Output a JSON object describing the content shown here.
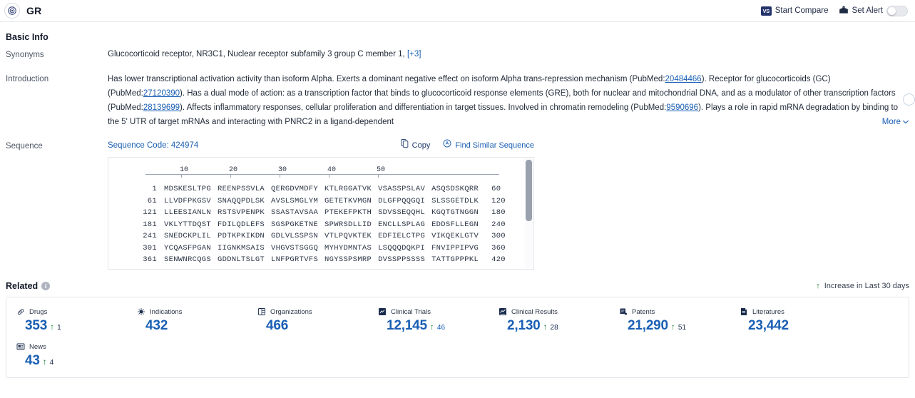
{
  "header": {
    "brand_title": "GR",
    "logo_icon": "target-icon",
    "start_compare_label": "Start Compare",
    "start_compare_badge": "VS",
    "set_alert_label": "Set Alert",
    "set_alert_icon": "alert-mailbox-icon",
    "toggle_state": "off"
  },
  "basic_info": {
    "title": "Basic Info",
    "synonyms": {
      "label": "Synonyms",
      "items": [
        "Glucocorticoid receptor,",
        "NR3C1,",
        "Nuclear receptor subfamily 3 group C member 1,"
      ],
      "more_label": "[+3]"
    },
    "introduction": {
      "label": "Introduction",
      "segments": [
        {
          "type": "text",
          "value": "Has lower transcriptional activation activity than isoform Alpha. Exerts a dominant negative effect on isoform Alpha trans-repression mechanism (PubMed:"
        },
        {
          "type": "link",
          "value": "20484466"
        },
        {
          "type": "text",
          "value": "). Receptor for glucocorticoids (GC) (PubMed:"
        },
        {
          "type": "link",
          "value": "27120390"
        },
        {
          "type": "text",
          "value": "). Has a dual mode of action: as a transcription factor that binds to glucocorticoid response elements (GRE), both for nuclear and mitochondrial DNA, and as a modulator of other transcription factors (PubMed:"
        },
        {
          "type": "link",
          "value": "28139699"
        },
        {
          "type": "text",
          "value": "). Affects inflammatory responses, cellular proliferation and differentiation in target tissues. Involved in chromatin remodeling (PubMed:"
        },
        {
          "type": "link",
          "value": "9590696"
        },
        {
          "type": "text",
          "value": "). Plays a role in rapid mRNA degradation by binding to the 5' UTR of target mRNAs and interacting with PNRC2 in a ligand-dependent"
        }
      ],
      "more_label": "More"
    }
  },
  "sequence": {
    "label": "Sequence",
    "code_label": "Sequence Code: 424974",
    "copy_label": "Copy",
    "copy_icon": "copy-icon",
    "find_similar_label": "Find Similar Sequence",
    "find_similar_icon": "find-similar-icon",
    "ruler_ticks": [
      10,
      20,
      30,
      40,
      50
    ],
    "rows": [
      {
        "start": "1",
        "chunks": [
          "MDSKESLTPG",
          "REENPSSVLA",
          "QERGDVMDFY",
          "KTLRGGATVK",
          "VSASSPSLAV",
          "ASQSDSKQRR"
        ],
        "end": "60"
      },
      {
        "start": "61",
        "chunks": [
          "LLVDFPKGSV",
          "SNAQQPDLSK",
          "AVSLSMGLYM",
          "GETETKVMGN",
          "DLGFPQQGQI",
          "SLSSGETDLK"
        ],
        "end": "120"
      },
      {
        "start": "121",
        "chunks": [
          "LLEESIANLN",
          "RSTSVPENPK",
          "SSASTAVSAA",
          "PTEKEFPKTH",
          "SDVSSEQQHL",
          "KGQTGTNGGN"
        ],
        "end": "180"
      },
      {
        "start": "181",
        "chunks": [
          "VKLYTTDQST",
          "FDILQDLEFS",
          "SGSPGKETNE",
          "SPWRSDLLID",
          "ENCLLSPLAG",
          "EDDSFLLEGN"
        ],
        "end": "240"
      },
      {
        "start": "241",
        "chunks": [
          "SNEDCKPLIL",
          "PDTKPKIKDN",
          "GDLVLSSPSN",
          "VTLPQVKTEK",
          "EDFIELCTPG",
          "VIKQEKLGTV"
        ],
        "end": "300"
      },
      {
        "start": "301",
        "chunks": [
          "YCQASFPGAN",
          "IIGNKMSAIS",
          "VHGVSTSGGQ",
          "MYHYDMNTAS",
          "LSQQQDQKPI",
          "FNVIPPIPVG"
        ],
        "end": "360"
      },
      {
        "start": "361",
        "chunks": [
          "SENWNRCQGS",
          "GDDNLTSLGT",
          "LNFPGRTVFS",
          "NGYSSPSMRP",
          "DVSSPPSSSS",
          "TATTGPPPKL"
        ],
        "end": "420"
      }
    ]
  },
  "related": {
    "title": "Related",
    "info_icon": "info-icon",
    "legend_label": "Increase in Last 30 days",
    "legend_arrow": "↑",
    "cards": [
      {
        "label": "Drugs",
        "icon": "capsule-icon",
        "value": "353",
        "delta": "1",
        "delta_color": "dark"
      },
      {
        "label": "Indications",
        "icon": "virus-icon",
        "value": "432",
        "delta": "",
        "delta_color": ""
      },
      {
        "label": "Organizations",
        "icon": "building-icon",
        "value": "466",
        "delta": "",
        "delta_color": ""
      },
      {
        "label": "Clinical Trials",
        "icon": "clinical-trial-icon",
        "value": "12,145",
        "delta": "46",
        "delta_color": "blue"
      },
      {
        "label": "Clinical Results",
        "icon": "clinical-result-icon",
        "value": "2,130",
        "delta": "28",
        "delta_color": "dark"
      },
      {
        "label": "Patents",
        "icon": "patent-icon",
        "value": "21,290",
        "delta": "51",
        "delta_color": "dark"
      },
      {
        "label": "Literatures",
        "icon": "literature-icon",
        "value": "23,442",
        "delta": "",
        "delta_color": ""
      },
      {
        "label": "News",
        "icon": "news-icon",
        "value": "43",
        "delta": "4",
        "delta_color": "dark"
      }
    ]
  },
  "colors": {
    "accent_blue": "#1a5fb4",
    "brand_navy": "#25336b",
    "increase_green": "#1a7f37"
  }
}
